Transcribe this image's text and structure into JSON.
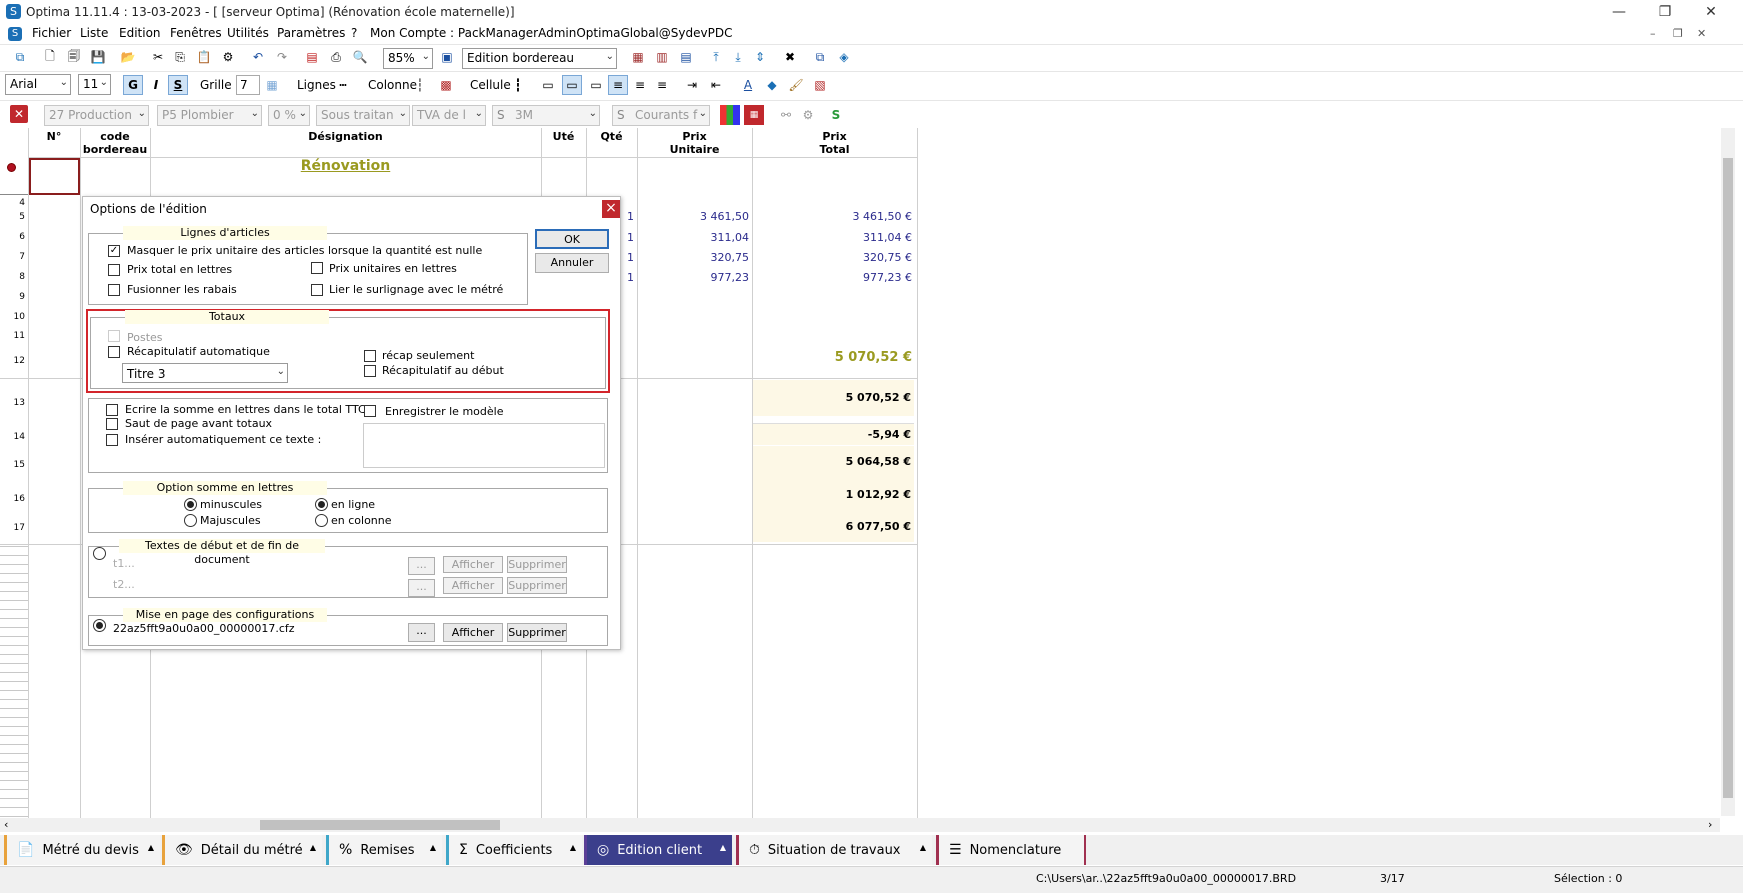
{
  "window": {
    "title": "Optima 11.11.4 : 13-03-2023 - [ [serveur Optima] (Rénovation école maternelle)]",
    "controls": {
      "minimize": "—",
      "restore": "❐",
      "close": "✕"
    }
  },
  "menu": {
    "items": [
      "Fichier",
      "Liste",
      "Edition",
      "Fenêtres",
      "Utilités",
      "Paramètres",
      "?",
      "Mon Compte : PackManagerAdminOptimaGlobal@SydevPDC"
    ]
  },
  "toolbar1": {
    "zoom": "85%",
    "mode": "Edition bordereau"
  },
  "toolbar2": {
    "font": "Arial",
    "size": "11",
    "bold": "G",
    "italic": "I",
    "strike": "S",
    "grille_label": "Grille",
    "grille_value": "7",
    "lignes_label": "Lignes",
    "colonne_label": "Colonne",
    "cellule_label": "Cellule"
  },
  "toolbar3": {
    "production": "27  Production",
    "plombier": "P5  Plombier",
    "pct": "0 %",
    "sous_traitant": "Sous traitan",
    "tva": "TVA de l",
    "unit": "3M",
    "courants": "Courants f"
  },
  "grid": {
    "headers": {
      "num": "N°",
      "code": "code\nbordereau",
      "designation": "Désignation",
      "ute": "Uté",
      "qte": "Qté",
      "pu": "Prix\nUnitaire",
      "pt": "Prix\nTotal"
    },
    "title": "Rénovation",
    "row_numbers": [
      "4",
      "5",
      "6",
      "7",
      "8",
      "9",
      "10",
      "11",
      "12",
      "13",
      "14",
      "15",
      "16",
      "17"
    ],
    "rows": [
      {
        "qte": "1",
        "pu": "3 461,50",
        "pt": "3 461,50 €"
      },
      {
        "qte": "1",
        "pu": "311,04",
        "pt": "311,04 €"
      },
      {
        "qte": "1",
        "pu": "320,75",
        "pt": "320,75 €"
      },
      {
        "qte": "1",
        "pu": "977,23",
        "pt": "977,23 €"
      }
    ],
    "subtotal": "5 070,52 €",
    "totals": [
      "5 070,52 €",
      "-5,94 €",
      "5 064,58 €",
      "1 012,92 €",
      "6 077,50 €"
    ]
  },
  "dialog": {
    "title": "Options de l'édition",
    "close": "×",
    "ok": "OK",
    "cancel": "Annuler",
    "lignes": {
      "title": "Lignes d'articles",
      "masquer": "Masquer le prix unitaire des articles lorsque la quantité est nulle",
      "prix_total_lettres": "Prix total en lettres",
      "prix_unit_lettres": "Prix unitaires en lettres",
      "fusionner": "Fusionner les rabais",
      "lier": "Lier le surlignage avec le métré"
    },
    "totaux": {
      "title": "Totaux",
      "postes": "Postes",
      "recap_auto": "Récapitulatif automatique",
      "recap_seulement": "récap seulement",
      "recap_debut": "Récapitulatif au début",
      "titre": "Titre 3"
    },
    "other": {
      "ecrire": "Ecrire la somme en lettres dans le total TTC",
      "saut": "Saut de page avant totaux",
      "inserer": "Insérer automatiquement ce texte :",
      "enregistrer": "Enregistrer le modèle"
    },
    "somme": {
      "title": "Option somme en lettres",
      "minuscules": "minuscules",
      "majuscules": "Majuscules",
      "en_ligne": "en ligne",
      "en_colonne": "en colonne"
    },
    "textes": {
      "title": "Textes de début et de fin de document",
      "t1": "t1...",
      "t2": "t2...",
      "dots": "...",
      "afficher": "Afficher",
      "supprimer": "Supprimer"
    },
    "mise": {
      "title": "Mise en page des configurations",
      "file": "22az5fft9a0u0a00_00000017.cfz",
      "dots": "...",
      "afficher": "Afficher",
      "supprimer": "Supprimer"
    }
  },
  "tabs": [
    {
      "label": "Métré du devis",
      "icon": "📄",
      "color": "#e8a23c"
    },
    {
      "label": "Détail du métré",
      "icon": "👁",
      "color": "#e8a23c"
    },
    {
      "label": "Remises",
      "icon": "%",
      "color": "#3fa7c9"
    },
    {
      "label": "Coefficients",
      "icon": "Σ",
      "color": "#3fa7c9"
    },
    {
      "label": "Edition client",
      "icon": "◎",
      "color": "#5b3f96"
    },
    {
      "label": "Situation de travaux",
      "icon": "⏱",
      "color": "#a03050"
    },
    {
      "label": "Nomenclature",
      "icon": "☰",
      "color": "#a03050"
    }
  ],
  "status": {
    "path": "C:\\Users\\ar..\\22az5fft9a0u0a00_00000017.BRD",
    "page": "3/17",
    "selection": "Sélection : 0"
  }
}
